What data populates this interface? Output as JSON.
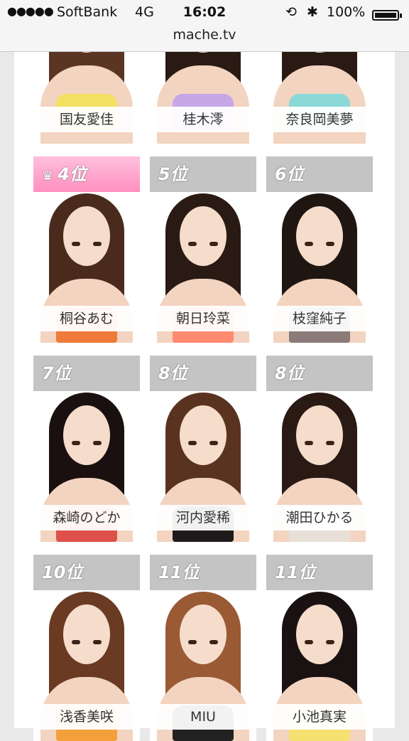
{
  "status_bar": {
    "signal_dots": "●●●●●",
    "carrier": "SoftBank",
    "network": "4G",
    "time": "16:02",
    "battery": "100%",
    "rotation_lock_icon": "rotation-lock-icon",
    "bluetooth_icon": "bluetooth-icon"
  },
  "browser": {
    "url": "mache.tv"
  },
  "top_row_names": [
    "国友愛佳",
    "桂木澪",
    "奈良岡美夢"
  ],
  "rows": [
    [
      {
        "rank": "4位",
        "name": "桐谷あむ",
        "highlight": true,
        "hair": "#4a2a1c",
        "top": "#f07a3a"
      },
      {
        "rank": "5位",
        "name": "朝日玲菜",
        "highlight": false,
        "hair": "#2a1a14",
        "top": "#ff8a70"
      },
      {
        "rank": "6位",
        "name": "枝窪純子",
        "highlight": false,
        "hair": "#1f1612",
        "top": "#8a7a78"
      }
    ],
    [
      {
        "rank": "7位",
        "name": "森崎のどか",
        "highlight": false,
        "hair": "#1a1010",
        "top": "#e0504a"
      },
      {
        "rank": "8位",
        "name": "河内愛稀",
        "highlight": false,
        "hair": "#5a3320",
        "top": "#1e1a1a"
      },
      {
        "rank": "8位",
        "name": "潮田ひかる",
        "highlight": false,
        "hair": "#2a1a14",
        "top": "#e8e0d8"
      }
    ],
    [
      {
        "rank": "10位",
        "name": "浅香美咲",
        "highlight": false,
        "hair": "#6a3a22",
        "top": "#f3a03a"
      },
      {
        "rank": "11位",
        "name": "MIU",
        "highlight": false,
        "hair": "#9a5a34",
        "top": "#222222"
      },
      {
        "rank": "11位",
        "name": "小池真実",
        "highlight": false,
        "hair": "#1a1212",
        "top": "#f5e070"
      }
    ]
  ],
  "colors": {
    "rank_grey": "#c4c4c4",
    "rank_pink": "#ff9cc8",
    "crown_icon": "crown-icon"
  }
}
